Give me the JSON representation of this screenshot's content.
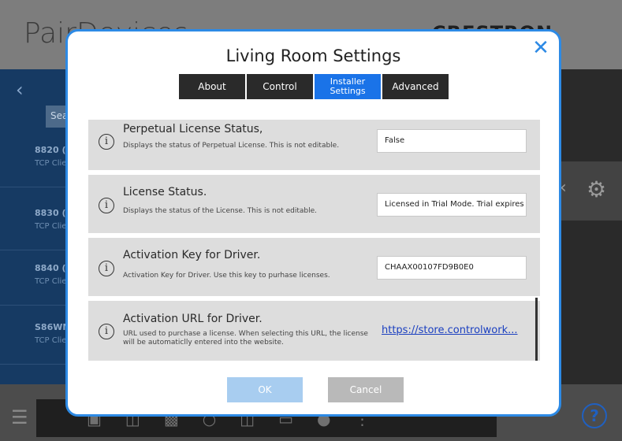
{
  "background": {
    "app_title": "PairDevices",
    "brand": "CRESTRON HOME",
    "search_label": "Sea",
    "devices": [
      {
        "name": "8820",
        "suffix": "(D",
        "sub": "TCP Clie"
      },
      {
        "name": "8830",
        "suffix": "(D",
        "sub": "TCP Clie"
      },
      {
        "name": "8840",
        "suffix": "(D",
        "sub": "TCP Clie"
      },
      {
        "name": "S86WM",
        "suffix": "",
        "sub": "TCP Clie"
      }
    ]
  },
  "modal": {
    "title": "Living Room Settings",
    "tabs": [
      {
        "label": "About"
      },
      {
        "label": "Control"
      },
      {
        "label": "Installer Settings"
      },
      {
        "label": "Advanced"
      }
    ],
    "settings": [
      {
        "title": "Perpetual License Status,",
        "description": "Displays the status of Perpetual License. This is not editable.",
        "value": "False"
      },
      {
        "title": "License Status.",
        "description": "Displays the status of the License. This is not editable.",
        "value": "Licensed in Trial Mode. Trial expires on"
      },
      {
        "title": "Activation Key for Driver.",
        "description": "Activation Key for Driver. Use this key to purhase licenses.",
        "value": "CHAAX00107FD9B0E0"
      },
      {
        "title": "Activation URL for Driver.",
        "description": "URL used to purchase a license. When selecting this URL, the license will be automaticlly entered into the website.",
        "link": "https://store.controlwork..."
      }
    ],
    "ok_label": "OK",
    "cancel_label": "Cancel"
  },
  "colors": {
    "accent": "#2d8ae5",
    "active_tab": "#1a73e8",
    "link": "#1a3fc0"
  }
}
